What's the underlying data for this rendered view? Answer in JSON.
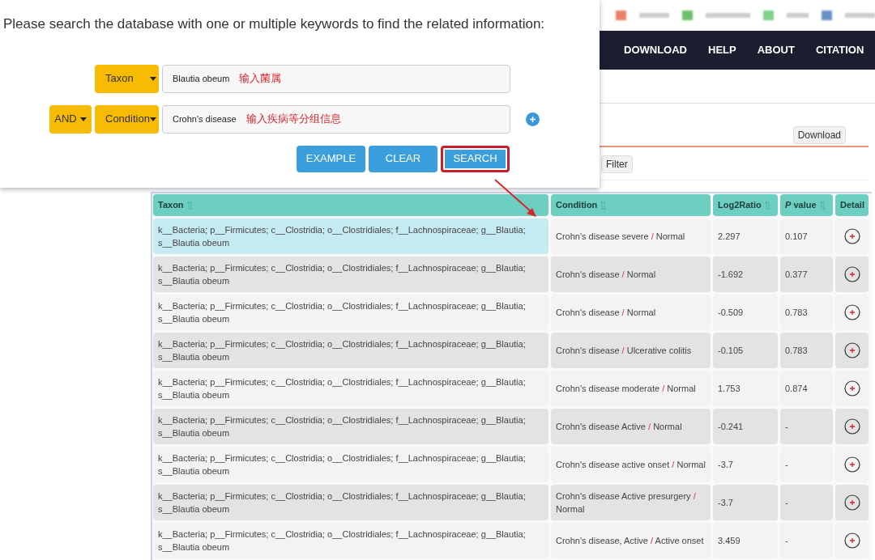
{
  "background_page": {
    "nav": [
      "DOWNLOAD",
      "HELP",
      "ABOUT",
      "CITATION"
    ],
    "download_button": "Download",
    "filter_button": "Filter"
  },
  "search_panel": {
    "prompt": "Please search the database with one or multiple keywords to find the related information:",
    "rows": [
      {
        "field": "Taxon",
        "value": "Blautia obeum",
        "annotation": "输入菌属"
      },
      {
        "operator": "AND",
        "field": "Condition",
        "value": "Crohn's disease",
        "annotation": "输入疾病等分组信息"
      }
    ],
    "buttons": [
      {
        "label": "EXAMPLE",
        "highlighted": false
      },
      {
        "label": "CLEAR",
        "highlighted": false
      },
      {
        "label": "SEARCH",
        "highlighted": true
      }
    ]
  },
  "table": {
    "columns": [
      {
        "label": "Taxon",
        "sortable": true
      },
      {
        "label": "Condition",
        "sortable": true
      },
      {
        "label": "Log2Ratio",
        "sortable": true
      },
      {
        "label": "*P* value",
        "sortable": true
      },
      {
        "label": "Detail",
        "sortable": false
      }
    ],
    "rows": [
      {
        "taxon": "k__Bacteria; p__Firmicutes; c__Clostridia; o__Clostridiales; f__Lachnospiraceae; g__Blautia; s__Blautia obeum",
        "condition": {
          "group": "Crohn's disease severe",
          "separator": "/",
          "reference": "Normal"
        },
        "log2ratio": "2.297",
        "p_value": "0.107",
        "selected": true
      },
      {
        "taxon": "k__Bacteria; p__Firmicutes; c__Clostridia; o__Clostridiales; f__Lachnospiraceae; g__Blautia; s__Blautia obeum",
        "condition": {
          "group": "Crohn's disease",
          "separator": "/",
          "reference": "Normal"
        },
        "log2ratio": "-1.692",
        "p_value": "0.377",
        "selected": false
      },
      {
        "taxon": "k__Bacteria; p__Firmicutes; c__Clostridia; o__Clostridiales; f__Lachnospiraceae; g__Blautia; s__Blautia obeum",
        "condition": {
          "group": "Crohn's disease",
          "separator": "/",
          "reference": "Normal"
        },
        "log2ratio": "-0.509",
        "p_value": "0.783",
        "selected": false
      },
      {
        "taxon": "k__Bacteria; p__Firmicutes; c__Clostridia; o__Clostridiales; f__Lachnospiraceae; g__Blautia; s__Blautia obeum",
        "condition": {
          "group": "Crohn's disease",
          "separator": "/",
          "reference": "Ulcerative colitis"
        },
        "log2ratio": "-0.105",
        "p_value": "0.783",
        "selected": false
      },
      {
        "taxon": "k__Bacteria; p__Firmicutes; c__Clostridia; o__Clostridiales; f__Lachnospiraceae; g__Blautia; s__Blautia obeum",
        "condition": {
          "group": "Crohn's disease moderate",
          "separator": "/",
          "reference": "Normal"
        },
        "log2ratio": "1.753",
        "p_value": "0.874",
        "selected": false
      },
      {
        "taxon": "k__Bacteria; p__Firmicutes; c__Clostridia; o__Clostridiales; f__Lachnospiraceae; g__Blautia; s__Blautia obeum",
        "condition": {
          "group": "Crohn's disease Active",
          "separator": "/",
          "reference": "Normal"
        },
        "log2ratio": "-0.241",
        "p_value": "-",
        "selected": false
      },
      {
        "taxon": "k__Bacteria; p__Firmicutes; c__Clostridia; o__Clostridiales; f__Lachnospiraceae; g__Blautia; s__Blautia obeum",
        "condition": {
          "group": "Crohn's disease active onset",
          "separator": "/",
          "reference": "Normal"
        },
        "log2ratio": "-3.7",
        "p_value": "-",
        "selected": false
      },
      {
        "taxon": "k__Bacteria; p__Firmicutes; c__Clostridia; o__Clostridiales; f__Lachnospiraceae; g__Blautia; s__Blautia obeum",
        "condition": {
          "group": "Crohn's disease Active presurgery",
          "separator": "/",
          "reference": "Normal"
        },
        "log2ratio": "-3.7",
        "p_value": "-",
        "selected": false
      },
      {
        "taxon": "k__Bacteria; p__Firmicutes; c__Clostridia; o__Clostridiales; f__Lachnospiraceae; g__Blautia; s__Blautia obeum",
        "condition": {
          "group": "Crohn's disease, Active",
          "separator": "/",
          "reference": "Active onset"
        },
        "log2ratio": "3.459",
        "p_value": "-",
        "selected": false
      }
    ]
  }
}
